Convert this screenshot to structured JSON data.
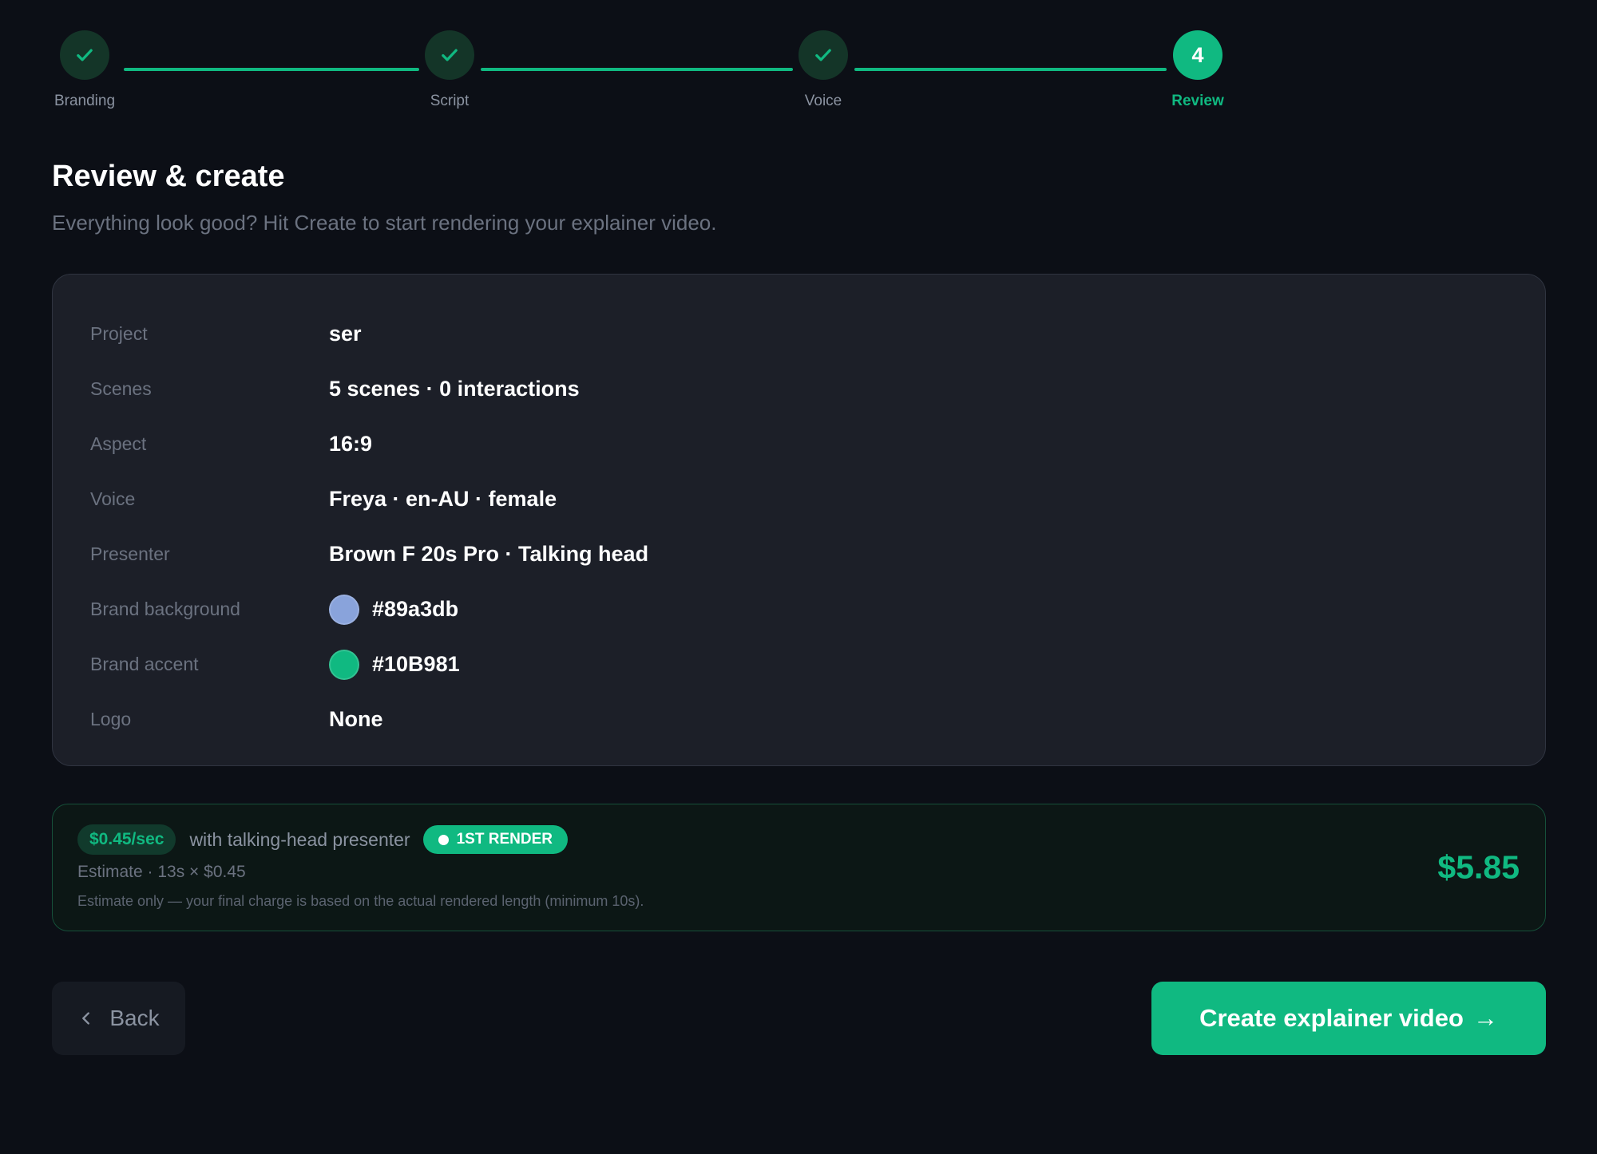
{
  "stepper": {
    "steps": [
      {
        "label": "Branding",
        "state": "done"
      },
      {
        "label": "Script",
        "state": "done"
      },
      {
        "label": "Voice",
        "state": "done"
      },
      {
        "label": "Review",
        "state": "active",
        "number": "4"
      }
    ]
  },
  "header": {
    "title": "Review & create",
    "subtitle": "Everything look good? Hit Create to start rendering your explainer video."
  },
  "summary": {
    "rows": [
      {
        "key": "Project",
        "value": "ser"
      },
      {
        "key": "Scenes",
        "value": "5 scenes · 0 interactions"
      },
      {
        "key": "Aspect",
        "value": "16:9"
      },
      {
        "key": "Voice",
        "value": "Freya · en-AU · female"
      },
      {
        "key": "Presenter",
        "value": "Brown F 20s Pro · Talking head"
      },
      {
        "key": "Brand background",
        "value": "#89a3db",
        "swatch": "#89a3db"
      },
      {
        "key": "Brand accent",
        "value": "#10B981",
        "swatch": "#10B981"
      },
      {
        "key": "Logo",
        "value": "None"
      }
    ]
  },
  "pricing": {
    "rate": "$0.45/sec",
    "description": "with talking-head presenter",
    "badge": "1ST RENDER",
    "estimate": "Estimate · 13s × $0.45",
    "note": "Estimate only — your final charge is based on the actual rendered length (minimum 10s).",
    "total": "$5.85"
  },
  "actions": {
    "back_label": "Back",
    "create_label": "Create explainer video",
    "create_arrow": "→"
  },
  "colors": {
    "accent": "#10B981",
    "background": "#0c0f16",
    "card": "#1c1f28"
  }
}
